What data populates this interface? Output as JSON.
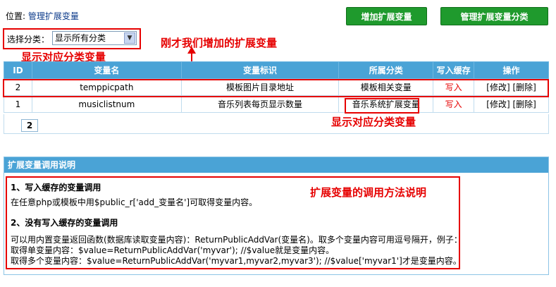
{
  "location": {
    "label": "位置:",
    "link": "管理扩展变量"
  },
  "toolbar": {
    "add_label": "增加扩展变量",
    "manage_label": "管理扩展变量分类"
  },
  "filter": {
    "label": "选择分类：",
    "selected": "显示所有分类"
  },
  "annotations": {
    "just_added": "刚才我们增加的扩展变量",
    "show_category_1": "显示对应分类变量",
    "show_category_2": "显示对应分类变量",
    "usage_note": "扩展变量的调用方法说明"
  },
  "table": {
    "headers": [
      "ID",
      "变量名",
      "变量标识",
      "所属分类",
      "写入缓存",
      "操作"
    ],
    "rows": [
      {
        "id": "2",
        "name": "temppicpath",
        "label": "模板图片目录地址",
        "category": "模板相关变量",
        "cache": "写入",
        "edit": "[修改]",
        "delete": "[删除]"
      },
      {
        "id": "1",
        "name": "musiclistnum",
        "label": "音乐列表每页显示数量",
        "category": "音乐系统扩展变量",
        "cache": "写入",
        "edit": "[修改]",
        "delete": "[删除]"
      }
    ]
  },
  "pagination": {
    "current": "2"
  },
  "help": {
    "title": "扩展变量调用说明",
    "s1_title": "1、写入缓存的变量调用",
    "s1_text": "在任意php或模板中用$public_r['add_变量名']可取得变量内容。",
    "s2_title": "2、没有写入缓存的变量调用",
    "s2_line1": "可以用内置变量返回函数(数据库读取变量内容)：ReturnPublicAddVar(变量名)。取多个变量内容可用逗号隔开，例子：",
    "s2_line2": "取得单变量内容：$value=ReturnPublicAddVar('myvar'); //$value就是变量内容。",
    "s2_line3": "取得多个变量内容：$value=ReturnPublicAddVar('myvar1,myvar2,myvar3'); //$value['myvar1']才是变量内容。"
  },
  "colors": {
    "accent_blue": "#4aa3d6",
    "button_green": "#1f9a2d",
    "annotation_red": "#e60000"
  }
}
